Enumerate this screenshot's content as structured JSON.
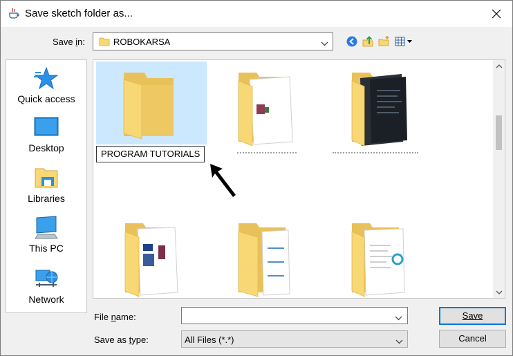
{
  "window": {
    "title": "Save sketch folder as..."
  },
  "save_in": {
    "label": "Save in:",
    "value": "ROBOKARSA"
  },
  "toolbar": {
    "icons": [
      "back-icon",
      "up-one-level-icon",
      "new-folder-icon",
      "view-menu-icon"
    ]
  },
  "places": [
    {
      "label": "Quick access",
      "icon": "star-icon"
    },
    {
      "label": "Desktop",
      "icon": "desktop-icon"
    },
    {
      "label": "Libraries",
      "icon": "libraries-icon"
    },
    {
      "label": "This PC",
      "icon": "computer-icon"
    },
    {
      "label": "Network",
      "icon": "network-icon"
    }
  ],
  "files": [
    {
      "name": "PROGRAM TUTORIALS",
      "selected": true,
      "icon": "folder-icon"
    },
    {
      "name": "",
      "selected": false,
      "icon": "folder-with-documents-icon"
    },
    {
      "name": "",
      "selected": false,
      "icon": "folder-with-screenshots-icon"
    },
    {
      "name": "",
      "selected": false,
      "icon": "folder-with-documents-icon"
    },
    {
      "name": "",
      "selected": false,
      "icon": "folder-with-documents-icon"
    },
    {
      "name": "",
      "selected": false,
      "icon": "folder-with-documents-icon"
    }
  ],
  "file_name": {
    "label": "File name:",
    "value": "",
    "placeholder": ""
  },
  "file_type": {
    "label": "Save as type:",
    "value": "All Files (*.*)"
  },
  "buttons": {
    "save": "Save",
    "cancel": "Cancel"
  },
  "colors": {
    "selection": "#cce8ff",
    "folder": "#f8d775",
    "accent": "#0078d7"
  }
}
